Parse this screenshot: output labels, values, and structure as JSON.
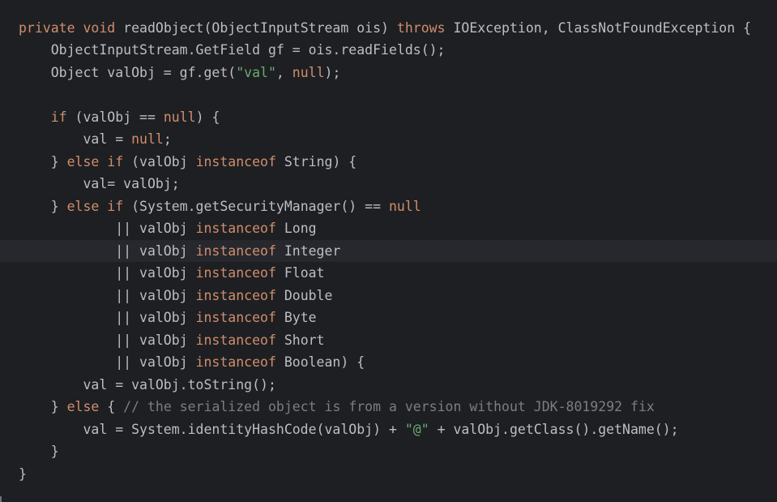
{
  "editor": {
    "colors": {
      "background": "#1e1f22",
      "current_line": "#26282e",
      "keyword": "#cf8e6d",
      "string": "#6aab73",
      "comment": "#7a7e85",
      "plain": "#bcbec4"
    },
    "current_line_index": 10,
    "lines": [
      [
        [
          "kw",
          "private void"
        ],
        [
          "p",
          " readObject(ObjectInputStream ois) "
        ],
        [
          "kw",
          "throws"
        ],
        [
          "p",
          " IOException, ClassNotFoundException {"
        ]
      ],
      [
        [
          "p",
          "    ObjectInputStream.GetField gf = ois.readFields();"
        ]
      ],
      [
        [
          "p",
          "    Object valObj = gf.get("
        ],
        [
          "str",
          "\"val\""
        ],
        [
          "p",
          ", "
        ],
        [
          "kw",
          "null"
        ],
        [
          "p",
          ");"
        ]
      ],
      [
        [
          "p",
          ""
        ]
      ],
      [
        [
          "p",
          "    "
        ],
        [
          "kw",
          "if"
        ],
        [
          "p",
          " (valObj == "
        ],
        [
          "kw",
          "null"
        ],
        [
          "p",
          ") {"
        ]
      ],
      [
        [
          "p",
          "        val = "
        ],
        [
          "kw",
          "null"
        ],
        [
          "p",
          ";"
        ]
      ],
      [
        [
          "p",
          "    } "
        ],
        [
          "kw",
          "else if"
        ],
        [
          "p",
          " (valObj "
        ],
        [
          "kw",
          "instanceof"
        ],
        [
          "p",
          " String) {"
        ]
      ],
      [
        [
          "p",
          "        val= valObj;"
        ]
      ],
      [
        [
          "p",
          "    } "
        ],
        [
          "kw",
          "else if"
        ],
        [
          "p",
          " (System.getSecurityManager() == "
        ],
        [
          "kw",
          "null"
        ]
      ],
      [
        [
          "p",
          "            || valObj "
        ],
        [
          "kw",
          "instanceof"
        ],
        [
          "p",
          " Long"
        ]
      ],
      [
        [
          "p",
          "            || valObj "
        ],
        [
          "kw",
          "instanceof"
        ],
        [
          "p",
          " Integer"
        ]
      ],
      [
        [
          "p",
          "            || valObj "
        ],
        [
          "kw",
          "instanceof"
        ],
        [
          "p",
          " Float"
        ]
      ],
      [
        [
          "p",
          "            || valObj "
        ],
        [
          "kw",
          "instanceof"
        ],
        [
          "p",
          " Double"
        ]
      ],
      [
        [
          "p",
          "            || valObj "
        ],
        [
          "kw",
          "instanceof"
        ],
        [
          "p",
          " Byte"
        ]
      ],
      [
        [
          "p",
          "            || valObj "
        ],
        [
          "kw",
          "instanceof"
        ],
        [
          "p",
          " Short"
        ]
      ],
      [
        [
          "p",
          "            || valObj "
        ],
        [
          "kw",
          "instanceof"
        ],
        [
          "p",
          " Boolean) {"
        ]
      ],
      [
        [
          "p",
          "        val = valObj.toString();"
        ]
      ],
      [
        [
          "p",
          "    } "
        ],
        [
          "kw",
          "else"
        ],
        [
          "p",
          " { "
        ],
        [
          "cmt",
          "// the serialized object is from a version without JDK-8019292 fix"
        ]
      ],
      [
        [
          "p",
          "        val = System.identityHashCode(valObj) + "
        ],
        [
          "str",
          "\"@\""
        ],
        [
          "p",
          " + valObj.getClass().getName();"
        ]
      ],
      [
        [
          "p",
          "    }"
        ]
      ],
      [
        [
          "p",
          "}"
        ]
      ]
    ]
  }
}
